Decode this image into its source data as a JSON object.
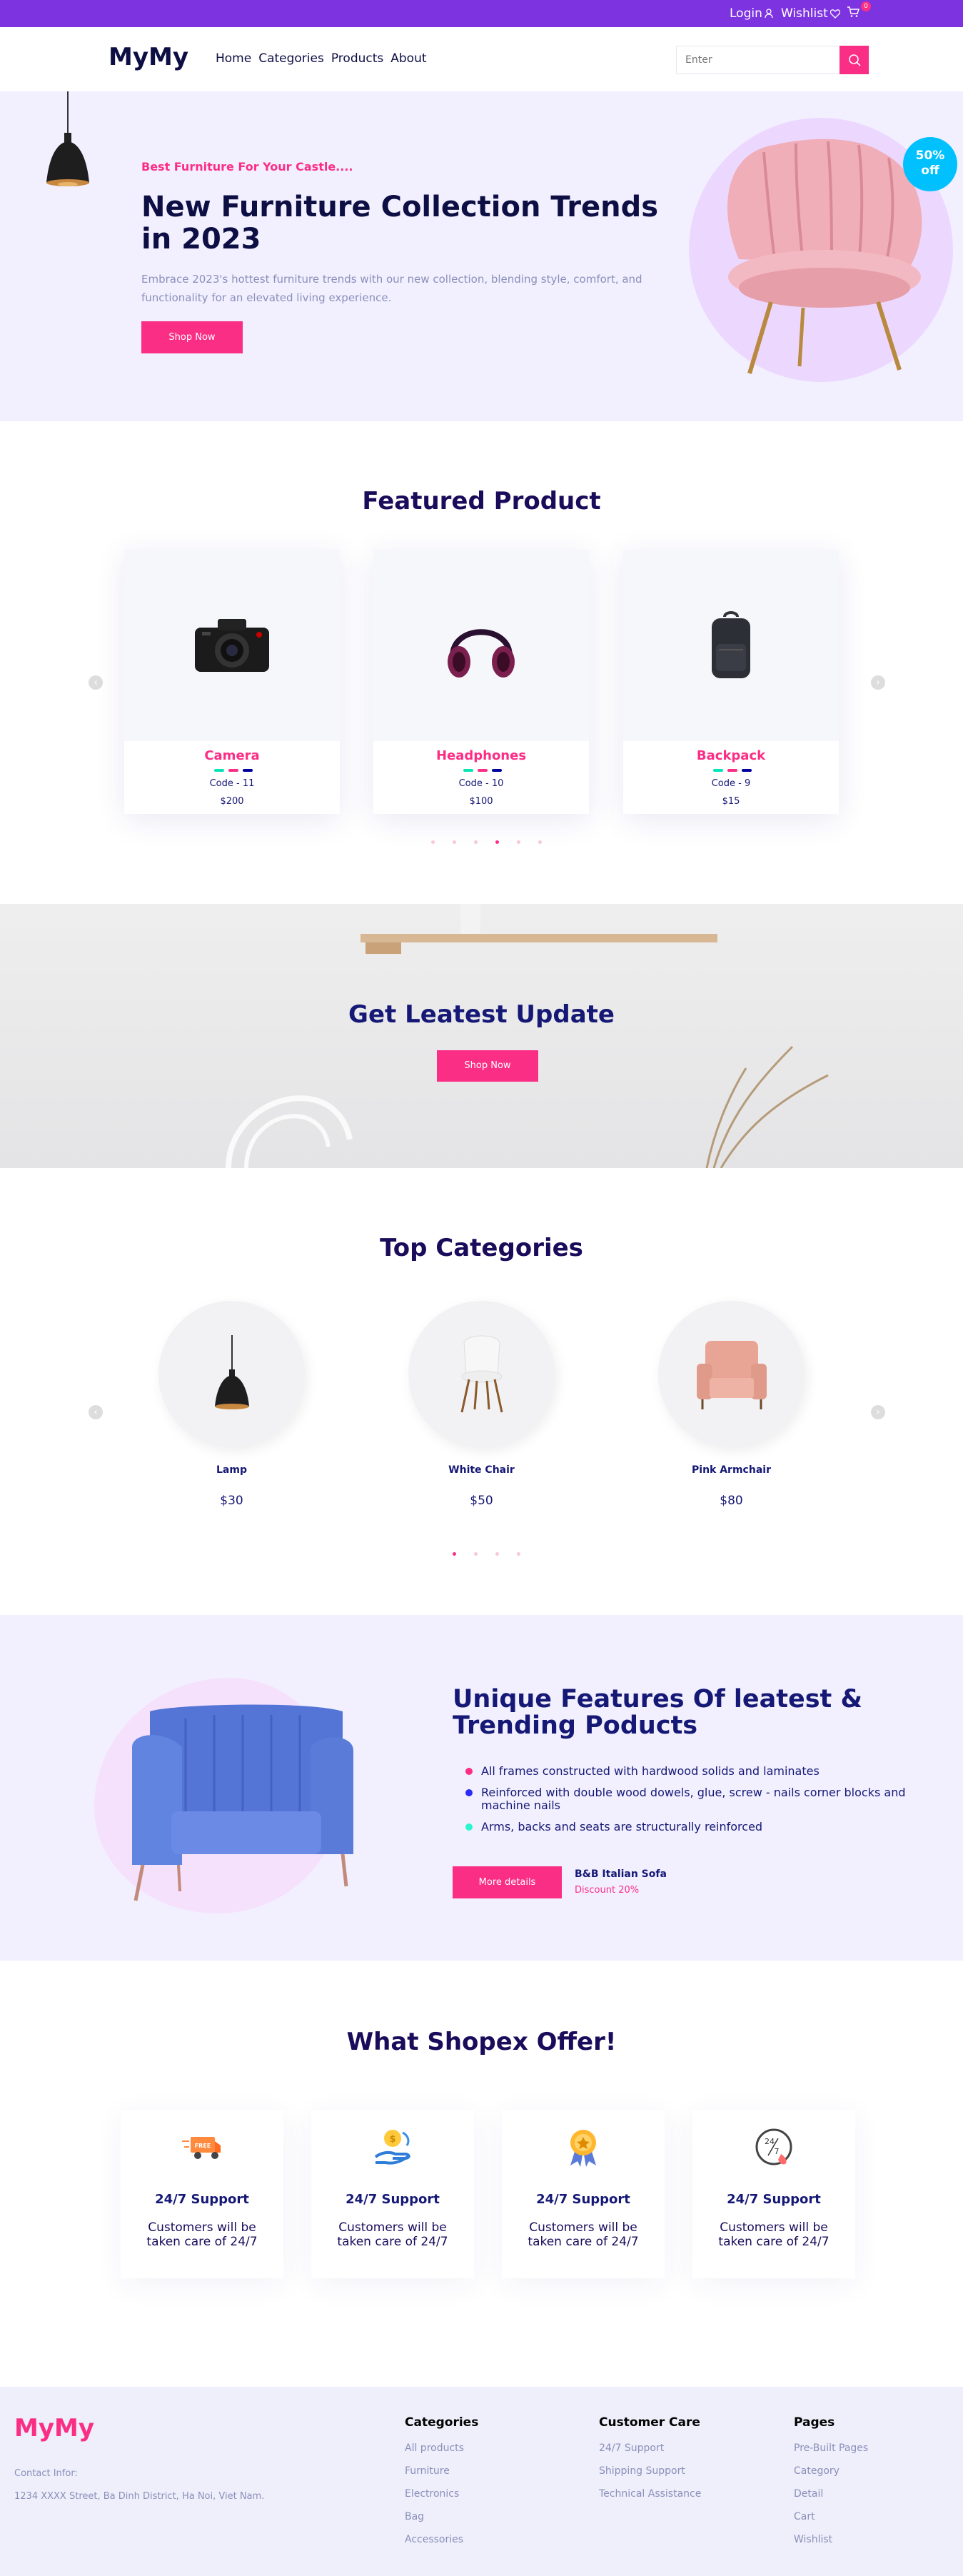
{
  "topbar": {
    "login": "Login",
    "wishlist": "Wishlist",
    "cart_count": "0"
  },
  "nav": {
    "logo": "MyMy",
    "menu": [
      "Home",
      "Categories",
      "Products",
      "About"
    ],
    "search_placeholder": "Enter"
  },
  "hero": {
    "subtitle": "Best Furniture For Your Castle....",
    "title": "New Furniture Collection Trends in 2023",
    "text": "Embrace 2023's hottest furniture trends with our new collection, blending style, comfort, and functionality for an elevated living experience.",
    "button": "Shop Now",
    "discount_value": "50%",
    "discount_label": "off"
  },
  "featured": {
    "title": "Featured Product",
    "products": [
      {
        "name": "Camera",
        "code": "Code - 11",
        "price": "$200",
        "icon": "camera-icon"
      },
      {
        "name": "Headphones",
        "code": "Code - 10",
        "price": "$100",
        "icon": "headphones-icon"
      },
      {
        "name": "Backpack",
        "code": "Code - 9",
        "price": "$15",
        "icon": "backpack-icon"
      }
    ],
    "swatch_colors": [
      "#05e6b7",
      "#fb2e86",
      "#00009d"
    ],
    "active_dot": 3
  },
  "update": {
    "title": "Get Leatest Update",
    "button": "Shop Now"
  },
  "categories": {
    "title": "Top Categories",
    "items": [
      {
        "name": "Lamp",
        "price": "$30",
        "icon": "lamp-icon"
      },
      {
        "name": "White Chair",
        "price": "$50",
        "icon": "white-chair-icon"
      },
      {
        "name": "Pink Armchair",
        "price": "$80",
        "icon": "armchair-icon"
      }
    ]
  },
  "unique": {
    "title": "Unique Features Of leatest & Trending Poducts",
    "features": [
      "All frames constructed with hardwood solids and laminates",
      "Reinforced with double wood dowels, glue, screw - nails corner blocks and machine nails",
      "Arms, backs and seats are structurally reinforced"
    ],
    "bullet_colors": [
      "#fb2e86",
      "#2b2bf5",
      "#2bf5cc"
    ],
    "button": "More details",
    "product_name": "B&B Italian Sofa",
    "product_discount": "Discount 20%"
  },
  "offer": {
    "title": "What Shopex Offer!",
    "items": [
      {
        "title": "24/7 Support",
        "text": "Customers will be taken care of 24/7",
        "icon": "free-delivery-icon"
      },
      {
        "title": "24/7 Support",
        "text": "Customers will be taken care of 24/7",
        "icon": "cashback-icon"
      },
      {
        "title": "24/7 Support",
        "text": "Customers will be taken care of 24/7",
        "icon": "premium-quality-icon"
      },
      {
        "title": "24/7 Support",
        "text": "Customers will be taken care of 24/7",
        "icon": "support-24-7-icon"
      }
    ],
    "free_badge": "FREE",
    "clock_24": "24",
    "clock_7": "7"
  },
  "footer": {
    "logo": "MyMy",
    "contact_label": "Contact Infor:",
    "address": "1234 XXXX Street, Ba Dinh District, Ha Noi, Viet Nam.",
    "columns": [
      {
        "title": "Categories",
        "links": [
          "All products",
          "Furniture",
          "Electronics",
          "Bag",
          "Accessories"
        ]
      },
      {
        "title": "Customer Care",
        "links": [
          "24/7 Support",
          "Shipping Support",
          "Technical Assistance"
        ]
      },
      {
        "title": "Pages",
        "links": [
          "Pre-Built Pages",
          "Category",
          "Detail",
          "Cart",
          "Wishlist"
        ]
      }
    ]
  },
  "colors": {
    "brand": "#7e33e0",
    "accent": "#fb2e86",
    "navy": "#151875",
    "hero_bg": "#f2f0ff"
  }
}
